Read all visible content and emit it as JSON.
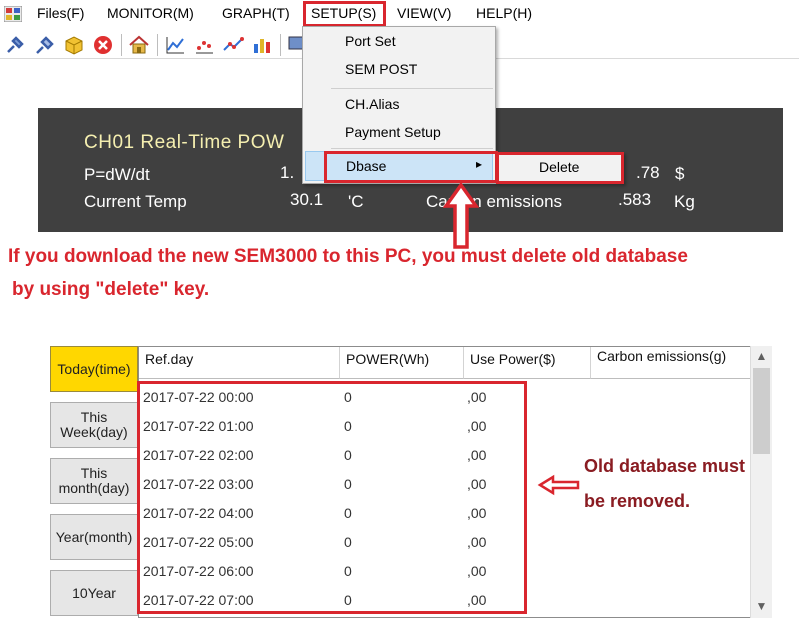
{
  "menubar": {
    "items": [
      "Files(F)",
      "MONITOR(M)",
      "GRAPH(T)",
      "SETUP(S)",
      "VIEW(V)",
      "HELP(H)"
    ]
  },
  "toolbar": {
    "icons": [
      "plug-connect-icon",
      "plug-disconnect-icon",
      "box-icon",
      "close-icon",
      "home-icon",
      "line-chart-icon",
      "scatter-chart-icon",
      "trend-chart-icon",
      "bar-chart-icon",
      "monitor-icon"
    ]
  },
  "panel": {
    "title": "CH01   Real-Time POW",
    "p_label": "P=dW/dt",
    "p_value": "1.",
    "cost_value": ".78",
    "cost_unit": "$",
    "temp_label": "Current Temp",
    "temp_value": "30.1",
    "temp_unit": "'C",
    "carbon_label": "Carbon emissions",
    "carbon_value": ".583",
    "carbon_unit": "Kg"
  },
  "setup_menu": {
    "port_set": "Port Set",
    "sem_post": "SEM POST",
    "ch_alias": "CH.Alias",
    "payment_setup": "Payment Setup",
    "dbase": "Dbase",
    "dbase_arrow": "▸",
    "delete": "Delete"
  },
  "annotations": {
    "notice_line1": "If you download the new SEM3000 to this PC, you must delete old database",
    "notice_line2": "by using \"delete\" key.",
    "remove_line1": "Old database must",
    "remove_line2": "be removed."
  },
  "period_buttons": [
    "Today(time)",
    "This Week(day)",
    "This month(day)",
    "Year(month)",
    "10Year"
  ],
  "table": {
    "headers": [
      "Ref.day",
      "POWER(Wh)",
      "Use Power($)",
      "Carbon emissions(g)"
    ],
    "rows": [
      [
        "2017-07-22 00:00",
        "0",
        ",00"
      ],
      [
        "2017-07-22 01:00",
        "0",
        ",00"
      ],
      [
        "2017-07-22 02:00",
        "0",
        ",00"
      ],
      [
        "2017-07-22 03:00",
        "0",
        ",00"
      ],
      [
        "2017-07-22 04:00",
        "0",
        ",00"
      ],
      [
        "2017-07-22 05:00",
        "0",
        ",00"
      ],
      [
        "2017-07-22 06:00",
        "0",
        ",00"
      ],
      [
        "2017-07-22 07:00",
        "0",
        ",00"
      ]
    ]
  },
  "scrollbar": {
    "up": "▲",
    "down": "▼"
  },
  "colors": {
    "highlight_red": "#d9262e",
    "dark_panel": "#404040",
    "active_button": "#ffd700",
    "menu_hover": "#cce4f7"
  }
}
